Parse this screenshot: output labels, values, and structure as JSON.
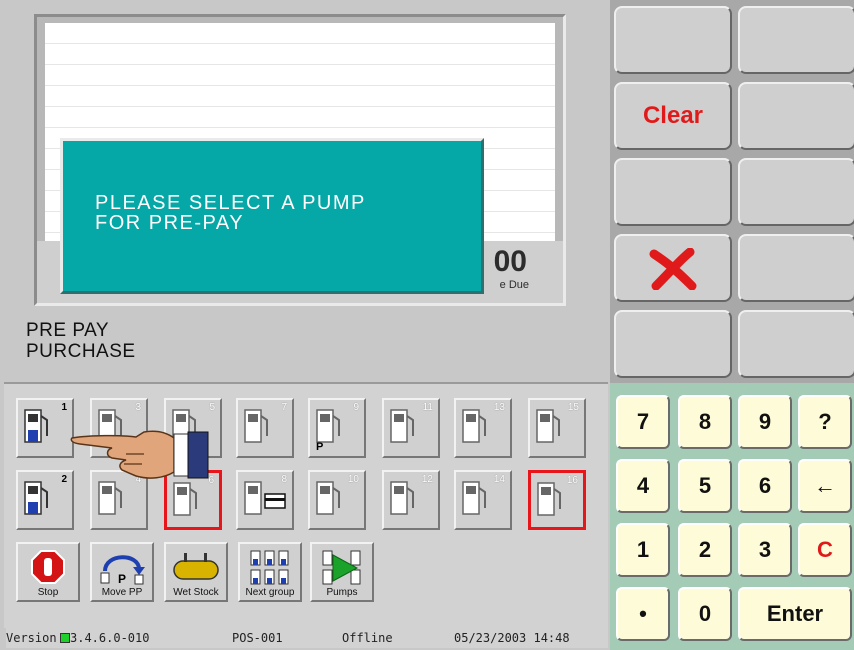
{
  "receipt": {
    "total_amount": "00",
    "total_label": "e Due"
  },
  "dialog": {
    "message": "PLEASE SELECT A PUMP\nFOR PRE-PAY"
  },
  "transaction": {
    "label": "PRE PAY\nPURCHASE"
  },
  "pumps": [
    {
      "number": "1",
      "state": "active"
    },
    {
      "number": "2",
      "state": "active"
    },
    {
      "number": "3",
      "state": "idle"
    },
    {
      "number": "4",
      "state": "idle"
    },
    {
      "number": "5",
      "state": "idle"
    },
    {
      "number": "6",
      "state": "alert"
    },
    {
      "number": "7",
      "state": "idle"
    },
    {
      "number": "8",
      "state": "card"
    },
    {
      "number": "9",
      "state": "prepay",
      "mark": "P"
    },
    {
      "number": "10",
      "state": "idle"
    },
    {
      "number": "11",
      "state": "idle"
    },
    {
      "number": "12",
      "state": "idle"
    },
    {
      "number": "13",
      "state": "idle"
    },
    {
      "number": "14",
      "state": "idle"
    },
    {
      "number": "15",
      "state": "idle"
    },
    {
      "number": "16",
      "state": "alert"
    }
  ],
  "functions": {
    "stop": "Stop",
    "move_pp": "Move PP",
    "wet_stock": "Wet Stock",
    "next_group": "Next group",
    "pumps": "Pumps"
  },
  "status": {
    "version_label": "Version",
    "version_number": "3.4.6.0-010",
    "terminal": "POS-001",
    "connection": "Offline",
    "datetime": "05/23/2003 14:48"
  },
  "function_keys": {
    "clear": "Clear"
  },
  "keypad": {
    "k7": "7",
    "k8": "8",
    "k9": "9",
    "help": "?",
    "k4": "4",
    "k5": "5",
    "k6": "6",
    "back": "←",
    "k1": "1",
    "k2": "2",
    "k3": "3",
    "clear_entry": "C",
    "dot": "•",
    "k0": "0",
    "enter": "Enter"
  },
  "colors": {
    "dialog_bg": "#06a7a7",
    "alert_border": "#e8151b",
    "keypad_bg": "#a4cbb5",
    "key_face": "#fdfbd8"
  }
}
